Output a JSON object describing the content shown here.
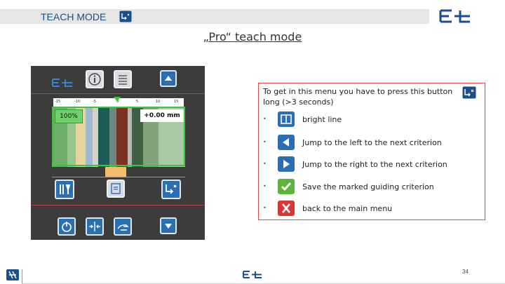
{
  "header": {
    "title": "TEACH MODE",
    "subtitle": "„Pro“ teach mode"
  },
  "device": {
    "percent": "100%",
    "offset": "+0.00 mm",
    "ruler_labels": [
      "-15",
      "-10",
      "-5",
      "0",
      "5",
      "10",
      "15"
    ]
  },
  "callout": {
    "intro": "To get in this menu you have to press this button long (>3 seconds)",
    "items": [
      {
        "icon": "bright-line-icon",
        "label": "bright line"
      },
      {
        "icon": "arrow-left-icon",
        "label": "Jump to the left to the next criterion"
      },
      {
        "icon": "arrow-right-icon",
        "label": "Jump to the right to the next criterion"
      },
      {
        "icon": "check-icon",
        "label": "Save the marked guiding criterion"
      },
      {
        "icon": "close-x-icon",
        "label": "back to the main menu"
      }
    ]
  },
  "footer": {
    "page_number": "34"
  },
  "colors": {
    "brand_blue": "#1a4f8c",
    "button_blue": "#2a6fb0",
    "check_green": "#5fb33a",
    "close_red": "#d83535",
    "callout_border": "#d84a4a"
  }
}
